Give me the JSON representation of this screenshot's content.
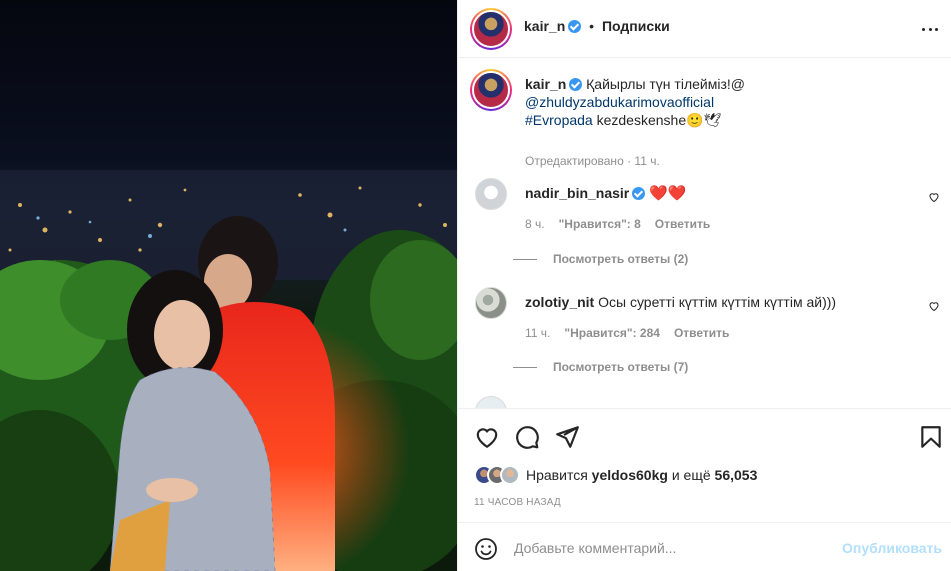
{
  "post": {
    "author": "kair_n",
    "follow_label": "Подписки",
    "separator": "•"
  },
  "caption": {
    "username": "kair_n",
    "text_main": "Қайырлы түн тілейміз!@",
    "mention": "@zhuldyzabdukarimova",
    "mention_suffix": "official",
    "hashtag": "#Evropada",
    "text_tail": "kezdeskenshe",
    "emojis": "🙂🕊",
    "edited_label": "Отредактировано",
    "edited_time": "11 ч."
  },
  "comments": [
    {
      "username": "nadir_bin_nasir",
      "verified": true,
      "text": "❤️❤️",
      "time": "8 ч.",
      "likes_label": "\"Нравится\": 8",
      "reply_label": "Ответить",
      "view_replies": "Посмотреть ответы (2)"
    },
    {
      "username": "zolotiy_nit",
      "verified": false,
      "text": "Осы суретті күттім күттім күттім ай)))",
      "time": "11 ч.",
      "likes_label": "\"Нравится\": 284",
      "reply_label": "Ответить",
      "view_replies": "Посмотреть ответы (7)"
    }
  ],
  "likes": {
    "prefix": "Нравится",
    "user": "yeldos60kg",
    "connector": "и ещё",
    "count": "56,053"
  },
  "timestamp": "11 часов назад",
  "composer": {
    "placeholder": "Добавьте комментарий...",
    "post_label": "Опубликовать"
  },
  "icons": {
    "like": "heart-icon",
    "comment": "comment-icon",
    "share": "share-icon",
    "save": "bookmark-icon",
    "emoji": "emoji-icon",
    "more": "more-icon"
  },
  "colors": {
    "verified": "#3897f0",
    "link": "#00376b",
    "secondary_text": "#8e8e8e",
    "post_button_disabled": "#b2dffc"
  }
}
